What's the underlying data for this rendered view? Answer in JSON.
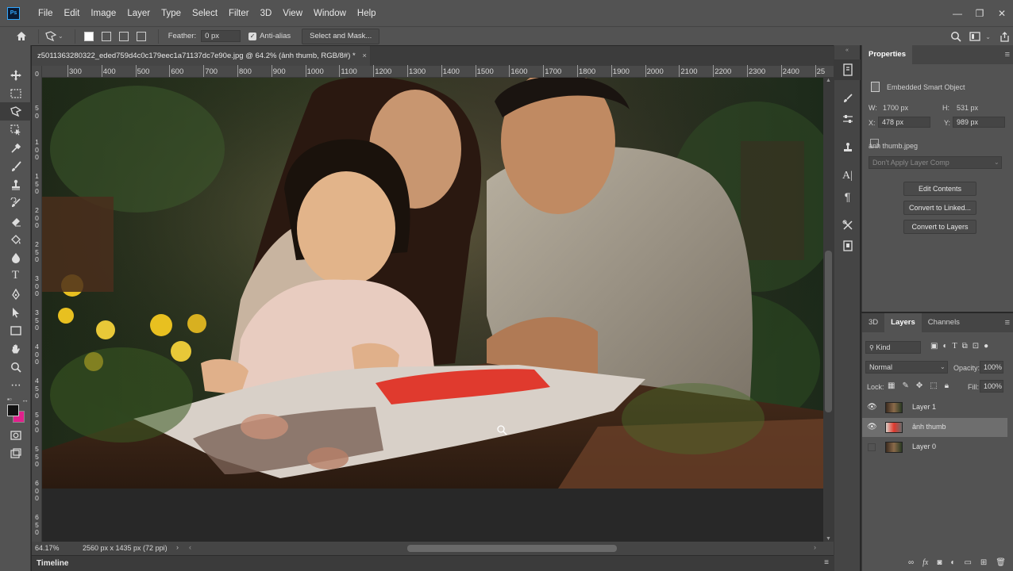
{
  "app": {
    "logo": "Ps"
  },
  "menu": [
    "File",
    "Edit",
    "Image",
    "Layer",
    "Type",
    "Select",
    "Filter",
    "3D",
    "View",
    "Window",
    "Help"
  ],
  "window_controls": [
    "—",
    "❐",
    "✕"
  ],
  "options_bar": {
    "feather_label": "Feather:",
    "feather_value": "0 px",
    "antialias_label": "Anti-alias",
    "select_mask_button": "Select and Mask..."
  },
  "document": {
    "tab_title": "z5011363280322_eded759d4c0c179eec1a71137dc7e90e.jpg @ 64.2% (ảnh thumb, RGB/8#) *",
    "close_glyph": "×"
  },
  "ruler": {
    "h_labels": [
      "300",
      "400",
      "500",
      "600",
      "700",
      "800",
      "900",
      "1000",
      "1100",
      "1200",
      "1300",
      "1400",
      "1500",
      "1600",
      "1700",
      "1800",
      "1900",
      "2000",
      "2100",
      "2200",
      "2300",
      "2400",
      "25"
    ],
    "v_labels": [
      "0",
      "5 0",
      "1 0 0",
      "1 5 0",
      "2 0 0",
      "2 5 0",
      "3 0 0",
      "3 5 0",
      "4 0 0",
      "4 5 0",
      "5 0 0",
      "5 5 0",
      "6 0 0",
      "6 5 0"
    ]
  },
  "status": {
    "zoom": "64.17%",
    "doc_size": "2560 px x 1435 px (72 ppi)"
  },
  "timeline": {
    "label": "Timeline"
  },
  "properties": {
    "tab": "Properties",
    "type": "Embedded Smart Object",
    "w_label": "W:",
    "w_value": "1700 px",
    "h_label": "H:",
    "h_value": "531 px",
    "x_label": "X:",
    "x_value": "478 px",
    "y_label": "Y:",
    "y_value": "989 px",
    "file": "ảnh thumb.jpeg",
    "layer_comp": "Don't Apply Layer Comp",
    "buttons": [
      "Edit Contents",
      "Convert to Linked...",
      "Convert to Layers"
    ]
  },
  "layers_panel": {
    "tabs": [
      "3D",
      "Layers",
      "Channels"
    ],
    "kind": "Kind",
    "blend_mode": "Normal",
    "opacity_label": "Opacity:",
    "opacity_value": "100%",
    "lock_label": "Lock:",
    "fill_label": "Fill:",
    "fill_value": "100%",
    "layers": [
      {
        "name": "Layer 1",
        "visible": true,
        "selected": false
      },
      {
        "name": "ảnh thumb",
        "visible": true,
        "selected": true
      },
      {
        "name": "Layer 0",
        "visible": false,
        "selected": false
      }
    ],
    "footer_icons": [
      "link-icon",
      "fx-icon",
      "mask-icon",
      "adjustment-icon",
      "group-icon",
      "new-layer-icon",
      "trash-icon"
    ]
  },
  "colors": {
    "foreground": "#111111",
    "background": "#e0208c",
    "accent": "#31a8ff"
  }
}
